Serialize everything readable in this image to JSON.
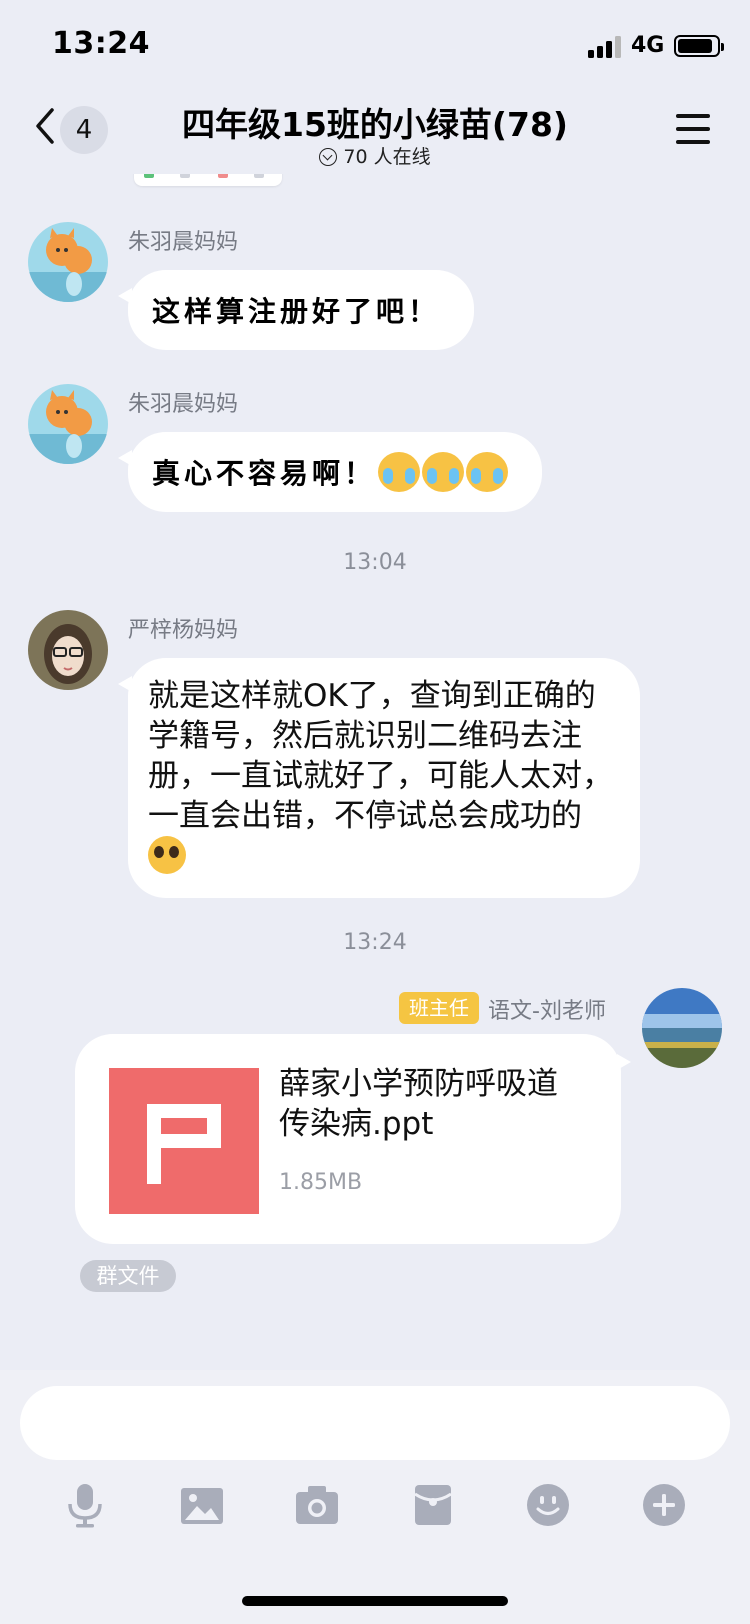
{
  "status_bar": {
    "time": "13:24",
    "network": "4G"
  },
  "header": {
    "unread_count": "4",
    "title": "四年级15班的小绿苗(78)",
    "online": "70 人在线"
  },
  "messages": [
    {
      "sender": "朱羽晨妈妈",
      "text": "这样算注册好了吧！"
    },
    {
      "sender": "朱羽晨妈妈",
      "text": "真心不容易啊！"
    },
    {
      "timestamp": "13:04"
    },
    {
      "sender": "严梓杨妈妈",
      "text": "就是这样就OK了，查询到正确的学籍号，然后就识别二维码去注册，一直试就好了，可能人太对，一直会出错，不停试总会成功的"
    },
    {
      "timestamp": "13:24"
    },
    {
      "role_badge": "班主任",
      "sender": "语文-刘老师",
      "file": {
        "name": "薛家小学预防呼吸道传染病.ppt",
        "size": "1.85MB"
      },
      "tag": "群文件"
    }
  ],
  "colors": {
    "background": "#ebedf5",
    "bubble": "#ffffff",
    "role_badge": "#f5c542",
    "ppt_icon": "#ef6b6b",
    "toolbar_icon": "#a9adba"
  },
  "toolbar": [
    "microphone-icon",
    "image-icon",
    "camera-icon",
    "red-packet-icon",
    "emoji-icon",
    "plus-icon"
  ]
}
